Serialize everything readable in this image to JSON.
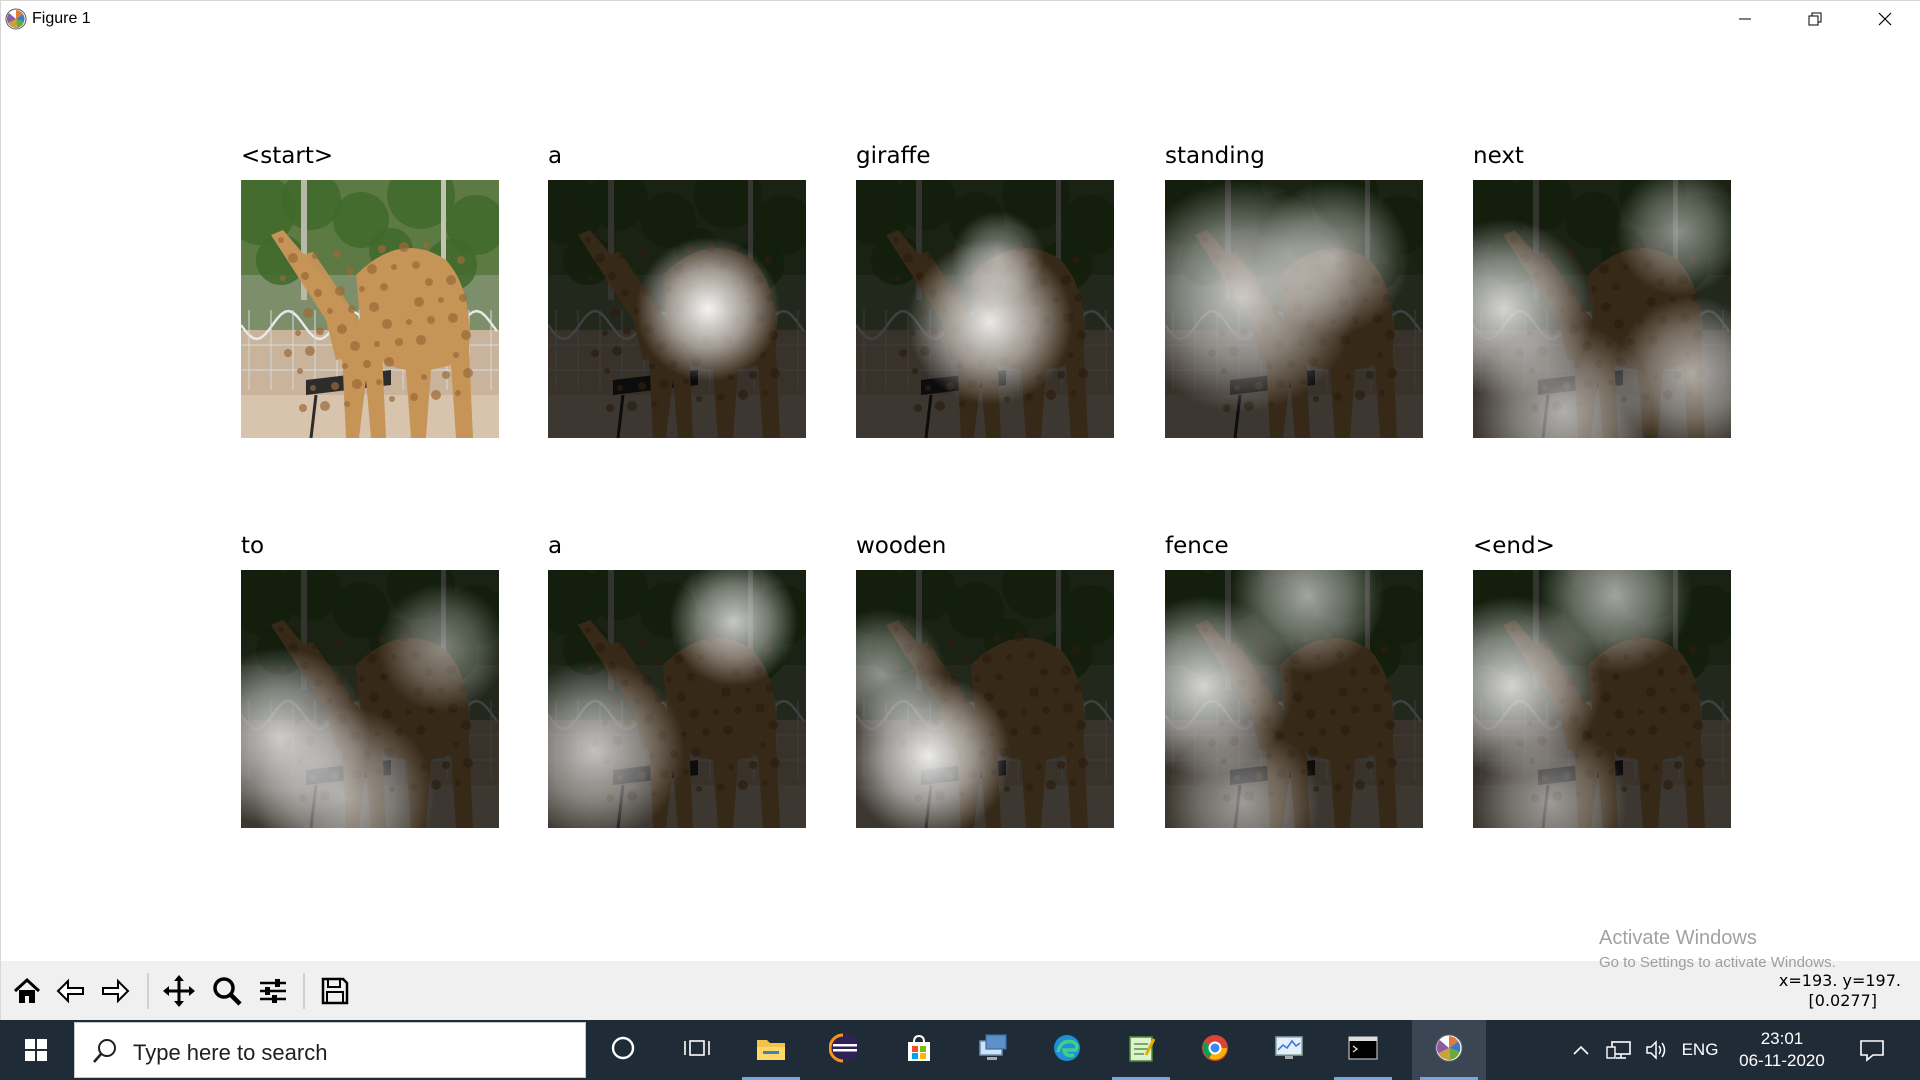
{
  "window": {
    "title": "Figure 1",
    "minimize_label": "Minimize",
    "maximize_label": "Restore",
    "close_label": "Close"
  },
  "figure": {
    "subplots": [
      {
        "title": "<start>",
        "attention": "none"
      },
      {
        "title": "a",
        "attention": "center-right"
      },
      {
        "title": "giraffe",
        "attention": "center"
      },
      {
        "title": "standing",
        "attention": "broad-left"
      },
      {
        "title": "next",
        "attention": "edges"
      },
      {
        "title": "to",
        "attention": "left-low"
      },
      {
        "title": "a",
        "attention": "top-right-and-bottom-left"
      },
      {
        "title": "wooden",
        "attention": "lower-left"
      },
      {
        "title": "fence",
        "attention": "left-and-top"
      },
      {
        "title": "<end>",
        "attention": "left-and-top"
      }
    ]
  },
  "toolbar": {
    "buttons": [
      {
        "name": "home-icon",
        "label": "Home"
      },
      {
        "name": "back-icon",
        "label": "Back"
      },
      {
        "name": "forward-icon",
        "label": "Forward"
      },
      {
        "name": "pan-icon",
        "label": "Pan"
      },
      {
        "name": "zoom-icon",
        "label": "Zoom"
      },
      {
        "name": "configure-subplots-icon",
        "label": "Configure subplots"
      },
      {
        "name": "save-icon",
        "label": "Save"
      }
    ],
    "coordinate_readout": "x=193. y=197.",
    "value_readout": "[0.0277]"
  },
  "watermark": {
    "line1": "Activate Windows",
    "line2": "Go to Settings to activate Windows."
  },
  "taskbar": {
    "search_placeholder": "Type here to search",
    "apps": [
      {
        "name": "cortana-icon"
      },
      {
        "name": "task-view-icon"
      },
      {
        "name": "file-explorer-icon"
      },
      {
        "name": "eclipse-icon"
      },
      {
        "name": "microsoft-store-icon"
      },
      {
        "name": "remote-desktop-icon"
      },
      {
        "name": "edge-icon"
      },
      {
        "name": "notepad-icon"
      },
      {
        "name": "chrome-icon"
      },
      {
        "name": "system-monitor-icon"
      },
      {
        "name": "terminal-icon"
      },
      {
        "name": "matplotlib-icon"
      }
    ],
    "language": "ENG",
    "time": "23:01",
    "date": "06-11-2020"
  },
  "colors": {
    "taskbar_bg": "#202b38",
    "toolbar_bg": "#f0f0f0",
    "window_bg": "#ffffff"
  }
}
